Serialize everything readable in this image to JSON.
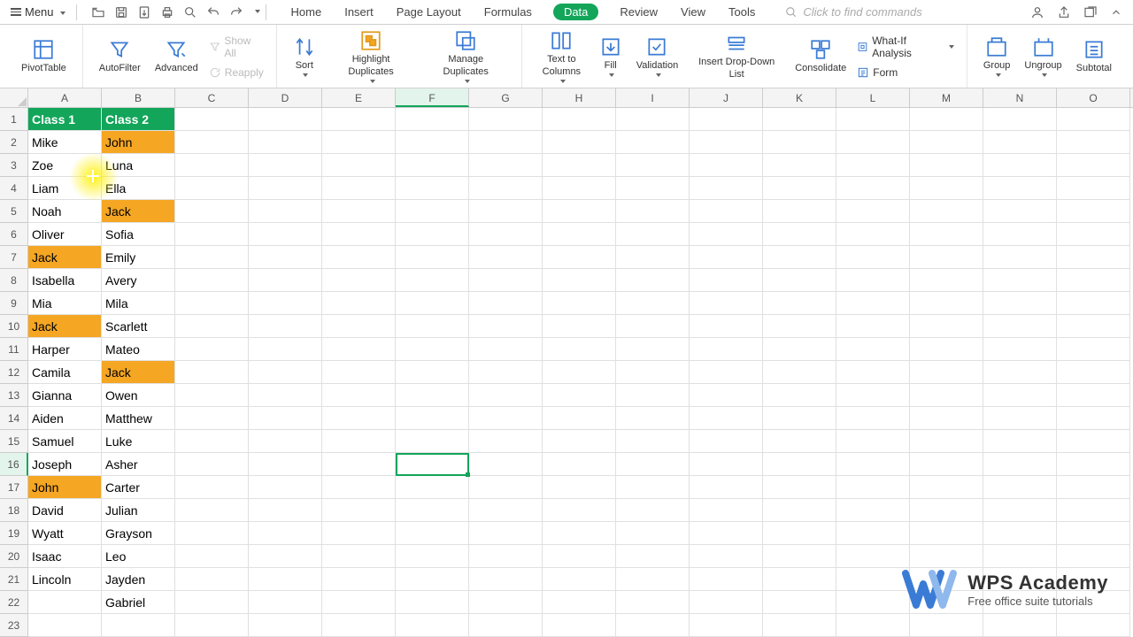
{
  "menubar": {
    "menu_label": "Menu",
    "tabs": [
      "Home",
      "Insert",
      "Page Layout",
      "Formulas",
      "Data",
      "Review",
      "View",
      "Tools"
    ],
    "active_tab": 4,
    "search_placeholder": "Click to find commands"
  },
  "ribbon": {
    "pivot": "PivotTable",
    "autofilter": "AutoFilter",
    "advanced": "Advanced",
    "show_all": "Show All",
    "reapply": "Reapply",
    "sort": "Sort",
    "highlight_dup": "Highlight Duplicates",
    "manage_dup": "Manage Duplicates",
    "text_to_columns": "Text to Columns",
    "fill": "Fill",
    "validation": "Validation",
    "insert_dropdown": "Insert Drop-Down List",
    "consolidate": "Consolidate",
    "whatif": "What-If Analysis",
    "form": "Form",
    "group": "Group",
    "ungroup": "Ungroup",
    "subtotal": "Subtotal"
  },
  "columns": [
    "A",
    "B",
    "C",
    "D",
    "E",
    "F",
    "G",
    "H",
    "I",
    "J",
    "K",
    "L",
    "M",
    "N",
    "O"
  ],
  "selected_col": 5,
  "selected_row": 16,
  "selected_cell": "F16",
  "data": [
    {
      "A": "Class 1",
      "B": "Class 2",
      "hdr": true
    },
    {
      "A": "Mike",
      "B": "John",
      "hlA": false,
      "hlB": true
    },
    {
      "A": "Zoe",
      "B": "Luna"
    },
    {
      "A": "Liam",
      "B": "Ella"
    },
    {
      "A": "Noah",
      "B": "Jack",
      "hlB": true
    },
    {
      "A": "Oliver",
      "B": "Sofia"
    },
    {
      "A": "Jack",
      "B": "Emily",
      "hlA": true
    },
    {
      "A": "Isabella",
      "B": "Avery"
    },
    {
      "A": "Mia",
      "B": "Mila"
    },
    {
      "A": "Jack",
      "B": "Scarlett",
      "hlA": true
    },
    {
      "A": "Harper",
      "B": "Mateo"
    },
    {
      "A": "Camila",
      "B": "Jack",
      "hlB": true
    },
    {
      "A": "Gianna",
      "B": "Owen"
    },
    {
      "A": "Aiden",
      "B": "Matthew"
    },
    {
      "A": "Samuel",
      "B": "Luke"
    },
    {
      "A": "Joseph",
      "B": "Asher"
    },
    {
      "A": "John",
      "B": "Carter",
      "hlA": true
    },
    {
      "A": "David",
      "B": "Julian"
    },
    {
      "A": "Wyatt",
      "B": "Grayson"
    },
    {
      "A": "Isaac",
      "B": "Leo"
    },
    {
      "A": "Lincoln",
      "B": "Jayden"
    },
    {
      "A": "",
      "B": "Gabriel"
    },
    {
      "A": "",
      "B": ""
    }
  ],
  "watermark": {
    "title": "WPS Academy",
    "subtitle": "Free office suite tutorials"
  }
}
